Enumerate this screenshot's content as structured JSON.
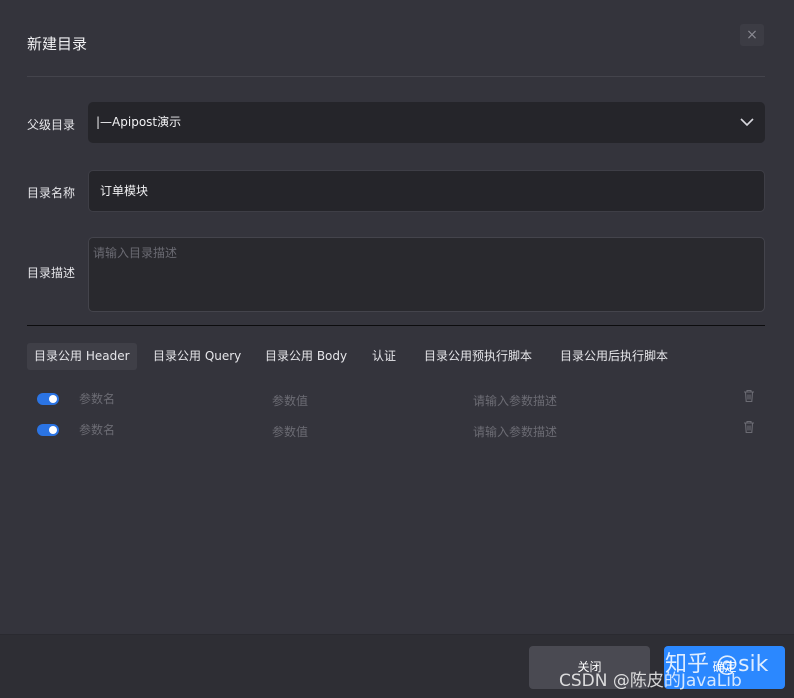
{
  "dialog": {
    "title": "新建目录",
    "close_glyph": "×"
  },
  "fields": {
    "parent": {
      "label": "父级目录",
      "value": "|—Apipost演示"
    },
    "name": {
      "label": "目录名称",
      "value": "订单模块"
    },
    "description": {
      "label": "目录描述",
      "placeholder": "请输入目录描述"
    }
  },
  "tabs": [
    {
      "label": "目录公用 Header",
      "active": true
    },
    {
      "label": "目录公用 Query"
    },
    {
      "label": "目录公用 Body"
    },
    {
      "label": "认证"
    },
    {
      "label": "目录公用预执行脚本"
    },
    {
      "label": "目录公用后执行脚本"
    }
  ],
  "params": [
    {
      "enabled": true,
      "name_placeholder": "参数名",
      "value_placeholder": "参数值",
      "desc_placeholder": "请输入参数描述"
    },
    {
      "enabled": true,
      "name_placeholder": "参数名",
      "value_placeholder": "参数值",
      "desc_placeholder": "请输入参数描述"
    }
  ],
  "footer": {
    "close_label": "关闭",
    "confirm_label": "确定"
  },
  "watermarks": {
    "zhihu": "知乎 @sik",
    "csdn": "CSDN @陈皮的JavaLib"
  },
  "colors": {
    "background": "#34343c",
    "input_bg": "#25252a",
    "accent": "#2b88ff",
    "toggle": "#2b74e4"
  },
  "icons": {
    "select_chevron": "chevron-down-icon",
    "row_delete": "trash-icon",
    "close": "close-icon"
  }
}
